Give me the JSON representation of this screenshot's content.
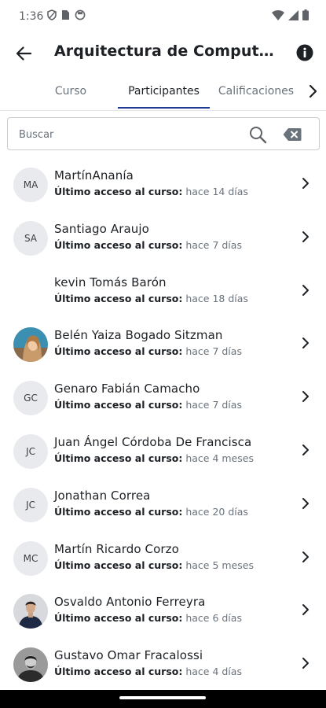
{
  "status_bar": {
    "time": "1:36",
    "icons_left": [
      "vpn-shield-icon",
      "sim-icon",
      "do-not-disturb-icon"
    ],
    "icons_right": [
      "wifi-icon",
      "signal-icon",
      "battery-icon"
    ]
  },
  "app_bar": {
    "title": "Arquitectura de Computadores",
    "back_icon": "arrow-back-icon",
    "info_icon": "info-icon"
  },
  "tabs": [
    {
      "label": "Curso",
      "active": false
    },
    {
      "label": "Participantes",
      "active": true
    },
    {
      "label": "Calificaciones",
      "active": false
    }
  ],
  "search": {
    "placeholder": "Buscar",
    "value": ""
  },
  "access_label": "Último acceso al curso:",
  "participants": [
    {
      "initials": "MA",
      "name": "MartínAnanía",
      "last_access": "hace 14 días",
      "avatar": "initials"
    },
    {
      "initials": "SA",
      "name": "Santiago Araujo",
      "last_access": "hace 7 días",
      "avatar": "initials"
    },
    {
      "initials": "",
      "name": "kevin Tomás Barón",
      "last_access": "hace 18 días",
      "avatar": "none"
    },
    {
      "initials": "",
      "name": "Belén Yaiza Bogado Sitzman",
      "last_access": "hace 7 días",
      "avatar": "photo"
    },
    {
      "initials": "GC",
      "name": "Genaro Fabián Camacho",
      "last_access": "hace 7 días",
      "avatar": "initials"
    },
    {
      "initials": "JC",
      "name": "Juan Ángel Córdoba De Francisca",
      "last_access": "hace 4 meses",
      "avatar": "initials"
    },
    {
      "initials": "JC",
      "name": "Jonathan Correa",
      "last_access": "hace 20 días",
      "avatar": "initials"
    },
    {
      "initials": "MC",
      "name": "Martín Ricardo Corzo",
      "last_access": "hace 5 meses",
      "avatar": "initials"
    },
    {
      "initials": "",
      "name": "Osvaldo Antonio Ferreyra",
      "last_access": "hace 6 días",
      "avatar": "photo"
    },
    {
      "initials": "",
      "name": "Gustavo Omar Fracalossi",
      "last_access": "hace 4 días",
      "avatar": "photo"
    }
  ],
  "colors": {
    "accent": "#1f3a93",
    "text_primary": "#1d2125",
    "text_secondary": "#6a737b",
    "avatar_bg": "#e8eaed"
  }
}
